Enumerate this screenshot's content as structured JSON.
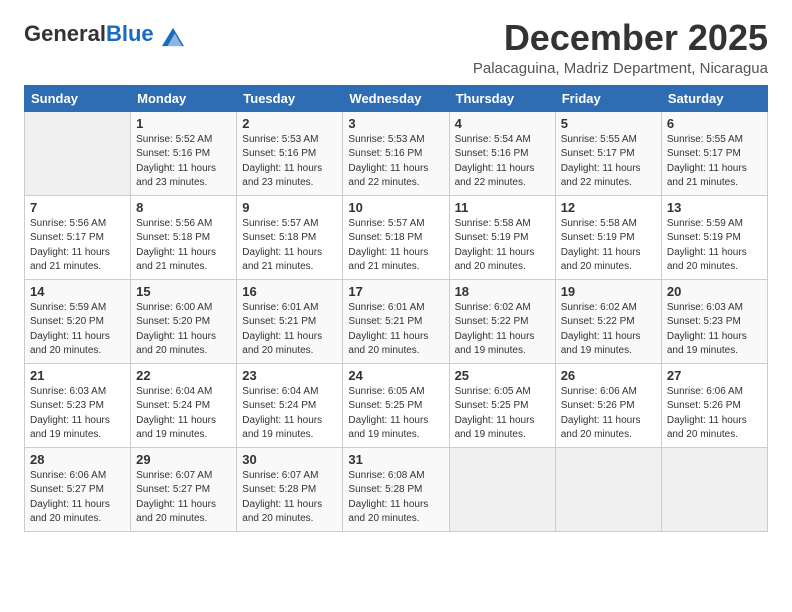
{
  "logo": {
    "general": "General",
    "blue": "Blue"
  },
  "title": "December 2025",
  "location": "Palacaguina, Madriz Department, Nicaragua",
  "days_header": [
    "Sunday",
    "Monday",
    "Tuesday",
    "Wednesday",
    "Thursday",
    "Friday",
    "Saturday"
  ],
  "weeks": [
    [
      {
        "num": "",
        "sunrise": "",
        "sunset": "",
        "daylight": ""
      },
      {
        "num": "1",
        "sunrise": "Sunrise: 5:52 AM",
        "sunset": "Sunset: 5:16 PM",
        "daylight": "Daylight: 11 hours and 23 minutes."
      },
      {
        "num": "2",
        "sunrise": "Sunrise: 5:53 AM",
        "sunset": "Sunset: 5:16 PM",
        "daylight": "Daylight: 11 hours and 23 minutes."
      },
      {
        "num": "3",
        "sunrise": "Sunrise: 5:53 AM",
        "sunset": "Sunset: 5:16 PM",
        "daylight": "Daylight: 11 hours and 22 minutes."
      },
      {
        "num": "4",
        "sunrise": "Sunrise: 5:54 AM",
        "sunset": "Sunset: 5:16 PM",
        "daylight": "Daylight: 11 hours and 22 minutes."
      },
      {
        "num": "5",
        "sunrise": "Sunrise: 5:55 AM",
        "sunset": "Sunset: 5:17 PM",
        "daylight": "Daylight: 11 hours and 22 minutes."
      },
      {
        "num": "6",
        "sunrise": "Sunrise: 5:55 AM",
        "sunset": "Sunset: 5:17 PM",
        "daylight": "Daylight: 11 hours and 21 minutes."
      }
    ],
    [
      {
        "num": "7",
        "sunrise": "Sunrise: 5:56 AM",
        "sunset": "Sunset: 5:17 PM",
        "daylight": "Daylight: 11 hours and 21 minutes."
      },
      {
        "num": "8",
        "sunrise": "Sunrise: 5:56 AM",
        "sunset": "Sunset: 5:18 PM",
        "daylight": "Daylight: 11 hours and 21 minutes."
      },
      {
        "num": "9",
        "sunrise": "Sunrise: 5:57 AM",
        "sunset": "Sunset: 5:18 PM",
        "daylight": "Daylight: 11 hours and 21 minutes."
      },
      {
        "num": "10",
        "sunrise": "Sunrise: 5:57 AM",
        "sunset": "Sunset: 5:18 PM",
        "daylight": "Daylight: 11 hours and 21 minutes."
      },
      {
        "num": "11",
        "sunrise": "Sunrise: 5:58 AM",
        "sunset": "Sunset: 5:19 PM",
        "daylight": "Daylight: 11 hours and 20 minutes."
      },
      {
        "num": "12",
        "sunrise": "Sunrise: 5:58 AM",
        "sunset": "Sunset: 5:19 PM",
        "daylight": "Daylight: 11 hours and 20 minutes."
      },
      {
        "num": "13",
        "sunrise": "Sunrise: 5:59 AM",
        "sunset": "Sunset: 5:19 PM",
        "daylight": "Daylight: 11 hours and 20 minutes."
      }
    ],
    [
      {
        "num": "14",
        "sunrise": "Sunrise: 5:59 AM",
        "sunset": "Sunset: 5:20 PM",
        "daylight": "Daylight: 11 hours and 20 minutes."
      },
      {
        "num": "15",
        "sunrise": "Sunrise: 6:00 AM",
        "sunset": "Sunset: 5:20 PM",
        "daylight": "Daylight: 11 hours and 20 minutes."
      },
      {
        "num": "16",
        "sunrise": "Sunrise: 6:01 AM",
        "sunset": "Sunset: 5:21 PM",
        "daylight": "Daylight: 11 hours and 20 minutes."
      },
      {
        "num": "17",
        "sunrise": "Sunrise: 6:01 AM",
        "sunset": "Sunset: 5:21 PM",
        "daylight": "Daylight: 11 hours and 20 minutes."
      },
      {
        "num": "18",
        "sunrise": "Sunrise: 6:02 AM",
        "sunset": "Sunset: 5:22 PM",
        "daylight": "Daylight: 11 hours and 19 minutes."
      },
      {
        "num": "19",
        "sunrise": "Sunrise: 6:02 AM",
        "sunset": "Sunset: 5:22 PM",
        "daylight": "Daylight: 11 hours and 19 minutes."
      },
      {
        "num": "20",
        "sunrise": "Sunrise: 6:03 AM",
        "sunset": "Sunset: 5:23 PM",
        "daylight": "Daylight: 11 hours and 19 minutes."
      }
    ],
    [
      {
        "num": "21",
        "sunrise": "Sunrise: 6:03 AM",
        "sunset": "Sunset: 5:23 PM",
        "daylight": "Daylight: 11 hours and 19 minutes."
      },
      {
        "num": "22",
        "sunrise": "Sunrise: 6:04 AM",
        "sunset": "Sunset: 5:24 PM",
        "daylight": "Daylight: 11 hours and 19 minutes."
      },
      {
        "num": "23",
        "sunrise": "Sunrise: 6:04 AM",
        "sunset": "Sunset: 5:24 PM",
        "daylight": "Daylight: 11 hours and 19 minutes."
      },
      {
        "num": "24",
        "sunrise": "Sunrise: 6:05 AM",
        "sunset": "Sunset: 5:25 PM",
        "daylight": "Daylight: 11 hours and 19 minutes."
      },
      {
        "num": "25",
        "sunrise": "Sunrise: 6:05 AM",
        "sunset": "Sunset: 5:25 PM",
        "daylight": "Daylight: 11 hours and 19 minutes."
      },
      {
        "num": "26",
        "sunrise": "Sunrise: 6:06 AM",
        "sunset": "Sunset: 5:26 PM",
        "daylight": "Daylight: 11 hours and 20 minutes."
      },
      {
        "num": "27",
        "sunrise": "Sunrise: 6:06 AM",
        "sunset": "Sunset: 5:26 PM",
        "daylight": "Daylight: 11 hours and 20 minutes."
      }
    ],
    [
      {
        "num": "28",
        "sunrise": "Sunrise: 6:06 AM",
        "sunset": "Sunset: 5:27 PM",
        "daylight": "Daylight: 11 hours and 20 minutes."
      },
      {
        "num": "29",
        "sunrise": "Sunrise: 6:07 AM",
        "sunset": "Sunset: 5:27 PM",
        "daylight": "Daylight: 11 hours and 20 minutes."
      },
      {
        "num": "30",
        "sunrise": "Sunrise: 6:07 AM",
        "sunset": "Sunset: 5:28 PM",
        "daylight": "Daylight: 11 hours and 20 minutes."
      },
      {
        "num": "31",
        "sunrise": "Sunrise: 6:08 AM",
        "sunset": "Sunset: 5:28 PM",
        "daylight": "Daylight: 11 hours and 20 minutes."
      },
      {
        "num": "",
        "sunrise": "",
        "sunset": "",
        "daylight": ""
      },
      {
        "num": "",
        "sunrise": "",
        "sunset": "",
        "daylight": ""
      },
      {
        "num": "",
        "sunrise": "",
        "sunset": "",
        "daylight": ""
      }
    ]
  ]
}
